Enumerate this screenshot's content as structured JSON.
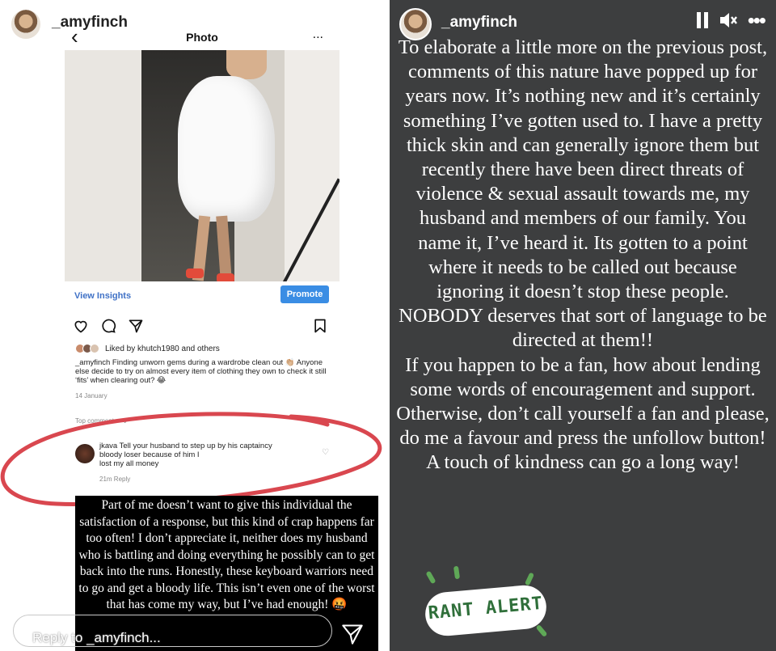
{
  "left_story": {
    "username": "_amyfinch",
    "post_header": {
      "title": "Photo",
      "more": "..."
    },
    "post": {
      "insights_label": "View Insights",
      "promote_label": "Promote",
      "liked_by": "Liked by khutch1980 and others",
      "caption": "_amyfinch Finding unworn gems during a wardrobe clean out 👏🏼 Anyone else decide to try on almost every item of clothing they own to check it still ‘fits’ when clearing out? 😂",
      "date": "14 January",
      "top_comments_label": "Top comments",
      "comment": {
        "text": "jkava Tell your husband to step up by his captaincy\nbloody loser                                       because of him I\nlost my all money",
        "meta": "21m     Reply"
      }
    },
    "overlay_text": "Part of me doesn’t want to give this individual the satisfaction of a response, but this kind of crap happens far too often! I don’t appreciate it, neither does my husband who is battling and doing everything he possibly can to get back into the runs. Honestly, these keyboard warriors need to go and get a bloody life. This isn’t even one of the worst that has come my way, but I’ve had enough! 🤬",
    "reply_placeholder": "Reply to _amyfinch..."
  },
  "right_story": {
    "username": "_amyfinch",
    "paragraphs": [
      "To elaborate a little more on the previous post, comments of this nature have popped up for years now. It’s nothing new and it’s certainly something I’ve gotten used to. I have a pretty thick skin and can generally ignore them but recently there have been direct threats of violence & sexual assault towards me, my husband and members of our family. You name it, I’ve heard it. Its gotten to a point where it needs to be called out because ignoring it doesn’t stop these people.",
      "NOBODY deserves that sort of language to be directed at them!!",
      "If you happen to be a fan, how about lending some words of encouragement and support. Otherwise, don’t call yourself a fan and please, do me a favour and press the unfollow button!",
      "A touch of kindness can go a long way!"
    ],
    "sticker_text": "RANT ALERT"
  },
  "colors": {
    "right_background": "#3d3e3f",
    "promote_blue": "#3a8de4",
    "annotation_red": "#d9474f",
    "sticker_green": "#2f6f3a"
  }
}
